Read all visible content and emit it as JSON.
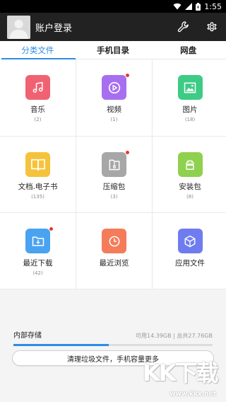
{
  "status_bar": {
    "time": "1:55",
    "colors": {
      "bg": "#000000"
    }
  },
  "app_bar": {
    "title": "账户登录"
  },
  "tabs": [
    {
      "label": "分类文件",
      "active": true
    },
    {
      "label": "手机目录",
      "active": false
    },
    {
      "label": "网盘",
      "active": false
    }
  ],
  "categories": [
    {
      "label": "音乐",
      "count": "(2)",
      "icon": "music-icon",
      "color": "#f06272",
      "badge": false
    },
    {
      "label": "视频",
      "count": "(1)",
      "icon": "video-icon",
      "color": "#a86ef0",
      "badge": true
    },
    {
      "label": "图片",
      "count": "(18)",
      "icon": "image-icon",
      "color": "#3dcb85",
      "badge": false
    },
    {
      "label": "文档.电子书",
      "count": "(135)",
      "icon": "book-icon",
      "color": "#f5c33b",
      "badge": false
    },
    {
      "label": "压缩包",
      "count": "(3)",
      "icon": "zip-icon",
      "color": "#a7a7a7",
      "badge": true
    },
    {
      "label": "安装包",
      "count": "(8)",
      "icon": "android-icon",
      "color": "#8fd14f",
      "badge": false
    },
    {
      "label": "最近下载",
      "count": "(42)",
      "icon": "download-folder-icon",
      "color": "#4aa3f0",
      "badge": true
    },
    {
      "label": "最近浏览",
      "count": "",
      "icon": "clock-icon",
      "color": "#f47c5a",
      "badge": false
    },
    {
      "label": "应用文件",
      "count": "",
      "icon": "cube-icon",
      "color": "#6f7cf0",
      "badge": false
    }
  ],
  "storage": {
    "label": "内部存储",
    "info": "可用14.39GB | 总共27.76GB",
    "used_fraction": 0.48,
    "clean_button": "清理垃圾文件，手机容量更多"
  },
  "watermark": {
    "text": "KK下载",
    "url": "www.kkx.net"
  },
  "colors": {
    "accent": "#2d8ce6",
    "appbar": "#222222"
  }
}
